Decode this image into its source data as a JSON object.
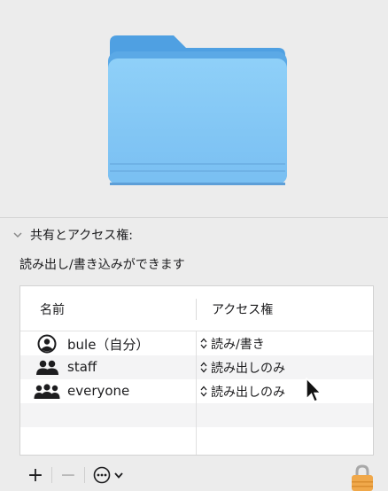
{
  "sharing": {
    "header": "共有とアクセス権:",
    "summary": "読み出し/書き込みができます"
  },
  "table": {
    "col_name": "名前",
    "col_access": "アクセス権",
    "rows": [
      {
        "name": "bule（自分）",
        "access": "読み/書き",
        "icon": "user-circle-icon"
      },
      {
        "name": "staff",
        "access": "読み出しのみ",
        "icon": "group-icon"
      },
      {
        "name": "everyone",
        "access": "読み出しのみ",
        "icon": "everyone-icon"
      }
    ]
  },
  "toolbar": {
    "add": "+",
    "remove": "−"
  },
  "colors": {
    "folder_blue": "#8ccdf7",
    "folder_tab": "#5aa8e6",
    "lock_orange": "#f0a84a"
  }
}
